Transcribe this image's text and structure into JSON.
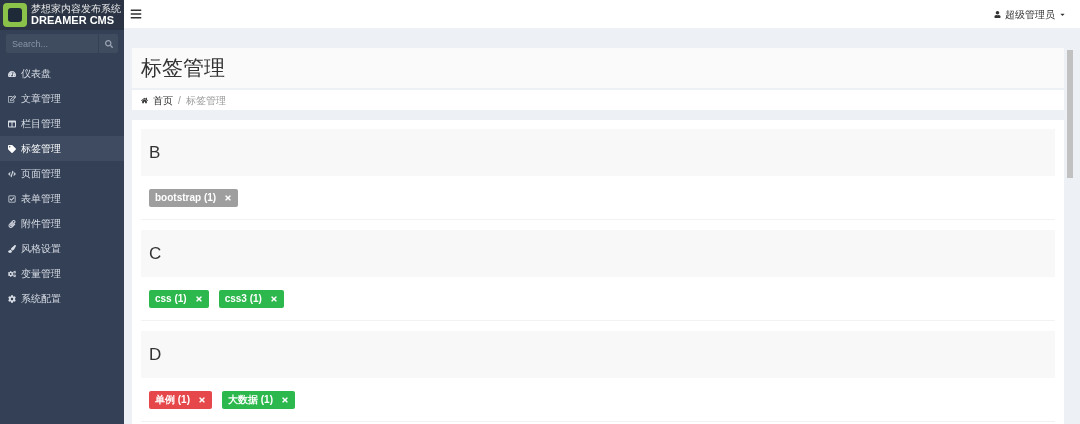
{
  "logo": {
    "title": "梦想家内容发布系统",
    "subtitle": "DREAMER CMS"
  },
  "search": {
    "placeholder": "Search..."
  },
  "sidebar": {
    "items": [
      {
        "label": "仪表盘",
        "selected": false
      },
      {
        "label": "文章管理",
        "selected": false
      },
      {
        "label": "栏目管理",
        "selected": false
      },
      {
        "label": "标签管理",
        "selected": true
      },
      {
        "label": "页面管理",
        "selected": false
      },
      {
        "label": "表单管理",
        "selected": false
      },
      {
        "label": "附件管理",
        "selected": false
      },
      {
        "label": "风格设置",
        "selected": false
      },
      {
        "label": "变量管理",
        "selected": false
      },
      {
        "label": "系统配置",
        "selected": false
      }
    ]
  },
  "user_menu": {
    "label": "超级管理员"
  },
  "page_title": "标签管理",
  "breadcrumb": [
    "首页",
    "标签管理"
  ],
  "breadcrumb_separator": "/",
  "groups": [
    {
      "letter": "B",
      "tags": [
        {
          "label": "bootstrap (1)",
          "color": "#9e9e9e"
        }
      ]
    },
    {
      "letter": "C",
      "tags": [
        {
          "label": "css (1)",
          "color": "#2db84d"
        },
        {
          "label": "css3 (1)",
          "color": "#2db84d"
        }
      ]
    },
    {
      "letter": "D",
      "tags": [
        {
          "label": "单例 (1)",
          "color": "#e5474b"
        },
        {
          "label": "大数据 (1)",
          "color": "#2db84d"
        }
      ]
    }
  ]
}
